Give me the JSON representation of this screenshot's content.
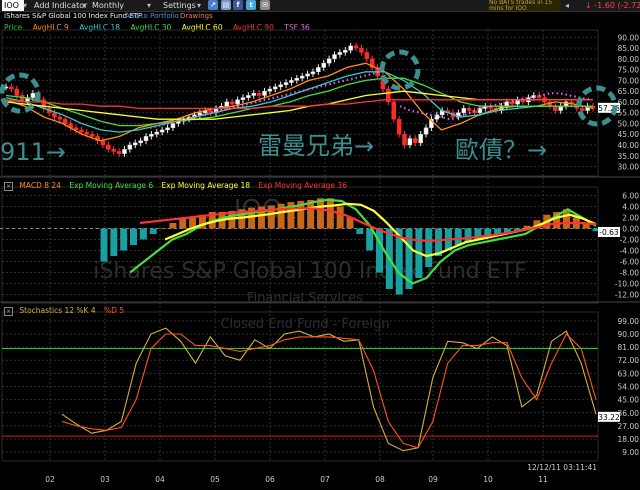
{
  "toolbar": {
    "symbol": "IOO",
    "add_indicator": "Add Indicator",
    "period": "Monthly",
    "settings": "Settings",
    "ticker_text": "No BATS trades in 15 mins for IOO",
    "last_change": "-1.60 (-2.72%)"
  },
  "header": {
    "name": "iShares S&P Global 100 Index Fund ETF",
    "add_portfolio": "Add to Portfolio",
    "drawings": "Drawings"
  },
  "legend_price": [
    {
      "label": "Price",
      "color": "#22cc22"
    },
    {
      "label": "AvgHLC 9",
      "color": "#ff8c1a"
    },
    {
      "label": "AvgHLC 18",
      "color": "#33cccc"
    },
    {
      "label": "AvgHLC 30",
      "color": "#44dd44"
    },
    {
      "label": "AvgHLC 60",
      "color": "#ffff33"
    },
    {
      "label": "AvgHLC 90",
      "color": "#ff3333"
    },
    {
      "label": "TSF 36",
      "color": "#dd66dd"
    }
  ],
  "legend_macd": [
    {
      "label": "MACD 8 24",
      "color": "#ff8c1a"
    },
    {
      "label": "Exp Moving Average 6",
      "color": "#44dd44"
    },
    {
      "label": "Exp Moving Average 18",
      "color": "#ffff33"
    },
    {
      "label": "Exp Moving Average 36",
      "color": "#ff3333"
    }
  ],
  "legend_stoch": [
    {
      "label": "Stochastics 12 %K 4",
      "color": "#d4b040"
    },
    {
      "label": "%D 5",
      "color": "#ff5522"
    }
  ],
  "annotations": {
    "a911": "911→",
    "lehman": "雷曼兄弟→",
    "euro": "歐債？→"
  },
  "watermark": {
    "symbol": "IOO",
    "name": "iShares S&P Global 100 Index Fund ETF",
    "sector": "Financial Services",
    "type": "Closed End Fund - Foreign"
  },
  "timestamp": "12/12/11 03:11:41",
  "chart_data": [
    {
      "type": "candlestick",
      "panel": "price",
      "y_ticks": [
        30,
        35,
        40,
        45,
        50,
        55,
        60,
        65,
        70,
        75,
        80,
        85,
        90
      ],
      "y_tick_labels": [
        "30.00",
        "35.00",
        "40.00",
        "45.00",
        "50.00",
        "55.00",
        "60.00",
        "65.00",
        "70.00",
        "75.00",
        "80.00",
        "85.00",
        "90.00"
      ],
      "ylim": [
        27,
        92
      ],
      "last_value": "57.26",
      "x_ticks": [
        "02",
        "03",
        "04",
        "05",
        "06",
        "07",
        "08",
        "09",
        "10",
        "11"
      ],
      "series": [
        {
          "name": "AvgHLC 9",
          "color": "#ff8c1a",
          "values": [
            61,
            58,
            53,
            50,
            45,
            42,
            44,
            48,
            50,
            52,
            55,
            57,
            58,
            60,
            63,
            66,
            70,
            72,
            76,
            78,
            74,
            66,
            55,
            47,
            50,
            54,
            57,
            58,
            58,
            60,
            59,
            57
          ]
        },
        {
          "name": "AvgHLC 18",
          "color": "#33cccc",
          "values": [
            62,
            60,
            57,
            54,
            50,
            47,
            46,
            47,
            49,
            51,
            53,
            55,
            57,
            58,
            60,
            63,
            66,
            69,
            72,
            74,
            74,
            70,
            64,
            56,
            53,
            54,
            56,
            57,
            58,
            58,
            58,
            58
          ]
        },
        {
          "name": "AvgHLC 30",
          "color": "#44dd44",
          "values": [
            63,
            62,
            60,
            57,
            54,
            51,
            49,
            49,
            50,
            51,
            52,
            53,
            55,
            57,
            58,
            60,
            63,
            65,
            68,
            70,
            71,
            71,
            68,
            64,
            60,
            58,
            58,
            58,
            58,
            58,
            58,
            58
          ]
        },
        {
          "name": "AvgHLC 60",
          "color": "#ffff33",
          "values": [
            60,
            59,
            58,
            57,
            56,
            55,
            54,
            53,
            52,
            52,
            52,
            52,
            53,
            54,
            55,
            56,
            58,
            59,
            61,
            63,
            64,
            65,
            64,
            63,
            62,
            61,
            61,
            61,
            61,
            61,
            61,
            61
          ]
        },
        {
          "name": "AvgHLC 90",
          "color": "#ff3333",
          "values": [
            61,
            60,
            60,
            59,
            59,
            58,
            58,
            57,
            57,
            57,
            57,
            57,
            57,
            57,
            58,
            58,
            58,
            59,
            59,
            60,
            61,
            61,
            61,
            61,
            61,
            61,
            61,
            61,
            61,
            61,
            61,
            61
          ]
        }
      ]
    },
    {
      "type": "bar+line",
      "panel": "macd",
      "y_ticks": [
        6,
        4,
        2,
        0,
        -2,
        -4,
        -6,
        -8,
        -10,
        -12
      ],
      "y_tick_labels": [
        "6.00",
        "4.00",
        "2.00",
        "0.00",
        "-2.00",
        "-4.00",
        "-6.00",
        "-8.00",
        "-10.00",
        "-12.00"
      ],
      "ylim": [
        -13,
        7
      ],
      "last_value": "-0.63",
      "histogram": [
        -6,
        -5,
        -4,
        -3,
        -2,
        -1,
        0,
        1,
        2,
        2,
        2.5,
        3,
        3,
        3.2,
        3.5,
        3.8,
        4,
        4.2,
        4.5,
        4.8,
        5,
        5.2,
        5.5,
        5.5,
        4,
        2,
        -1,
        -4,
        -8,
        -11,
        -12,
        -11,
        -9,
        -7,
        -5,
        -4,
        -3,
        -2.5,
        -2,
        -1.5,
        -1,
        -1,
        -0.5,
        0.5,
        1.5,
        2.5,
        3,
        3.5,
        2,
        1,
        -0.5
      ],
      "series": [
        {
          "name": "Exp Moving Average 6",
          "color": "#44dd44",
          "values": [
            -8,
            -6,
            -4,
            -2,
            -1,
            0.5,
            1.5,
            2.2,
            2.6,
            3,
            3.3,
            3.8,
            4.2,
            4.8,
            5.2,
            5,
            3.5,
            0.5,
            -4,
            -8,
            -10,
            -9,
            -6,
            -4,
            -3,
            -2.5,
            -2,
            -1.5,
            -1,
            0.5,
            2,
            3.5,
            2,
            0.5
          ]
        },
        {
          "name": "Exp Moving Average 18",
          "color": "#ffff33",
          "values": [
            -2,
            -1,
            0,
            0.8,
            1.4,
            1.8,
            2,
            2.3,
            2.6,
            3,
            3.3,
            3.7,
            4,
            4.2,
            4.5,
            4.3,
            3.2,
            1,
            -1.5,
            -4,
            -5,
            -4.5,
            -3.5,
            -2.5,
            -2,
            -1.5,
            -1,
            -0.5,
            0,
            1,
            2,
            2.5,
            1.8,
            0.8
          ]
        },
        {
          "name": "Exp Moving Average 36",
          "color": "#ff3333",
          "values": [
            1,
            1.3,
            1.6,
            1.9,
            2.2,
            2.5,
            2.8,
            3,
            3.2,
            3.4,
            3.6,
            3.7,
            3.6,
            3.2,
            2.4,
            1.2,
            0,
            -1,
            -1.8,
            -2.2,
            -2.2,
            -2,
            -1.8,
            -1.5,
            -1.2,
            -0.8,
            -0.3,
            0.2,
            0.8,
            1,
            1,
            0.8
          ]
        }
      ]
    },
    {
      "type": "line",
      "panel": "stochastics",
      "y_ticks": [
        99,
        90,
        81,
        72,
        63,
        54,
        45,
        36,
        27,
        18,
        9
      ],
      "y_tick_labels": [
        "99.00",
        "90.00",
        "81.00",
        "72.00",
        "63.00",
        "54.00",
        "45.00",
        "36.00",
        "27.00",
        "18.00",
        "9.00"
      ],
      "ylim": [
        5,
        103
      ],
      "last_value": "33.22",
      "reference_lines": [
        {
          "value": 80,
          "color": "#22cc22"
        },
        {
          "value": 20,
          "color": "#cc2222"
        }
      ],
      "series": [
        {
          "name": "Stochastics 12 %K 4",
          "color": "#d4b040",
          "values": [
            35,
            28,
            22,
            24,
            30,
            70,
            90,
            94,
            85,
            70,
            88,
            75,
            72,
            86,
            80,
            90,
            92,
            88,
            90,
            85,
            86,
            40,
            15,
            10,
            12,
            60,
            85,
            84,
            80,
            88,
            82,
            40,
            48,
            85,
            92,
            70,
            35
          ]
        },
        {
          "name": "%D 5",
          "color": "#ff5522",
          "values": [
            30,
            27,
            25,
            24,
            26,
            45,
            80,
            90,
            90,
            82,
            82,
            80,
            78,
            80,
            82,
            86,
            88,
            88,
            88,
            87,
            86,
            65,
            30,
            15,
            12,
            30,
            70,
            82,
            82,
            84,
            84,
            60,
            45,
            70,
            90,
            80,
            45
          ]
        }
      ]
    }
  ]
}
